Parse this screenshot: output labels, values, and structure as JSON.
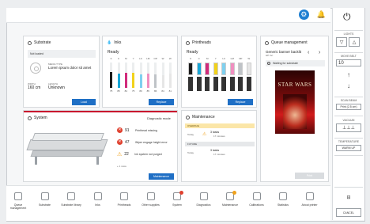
{
  "topbar": {
    "settings_icon": "gear-icon",
    "notifications_icon": "bell-icon"
  },
  "right_panel": {
    "power_icon": "power-icon",
    "lights_label": "LIGHTS",
    "movebelt_label": "MOVE BELT",
    "movebelt_value": "10",
    "scan_beam_label": "SCAN BEAM",
    "scan_beam_value": "Print (2.5 cm)",
    "vacuum_label": "VACUUM",
    "temperature_label": "TEMPERATURE",
    "temperature_value": "WARM UP",
    "cancel_label": "CANCEL"
  },
  "substrate": {
    "title": "Substrate",
    "status": "Not loaded",
    "media_type_label": "MEDIA TYPE",
    "media_type_value": "Lorem ipsum dolor sit amet",
    "width_label": "WIDTH",
    "width_value": "160 cm",
    "length_label": "LENGTH",
    "length_value": "Unknown",
    "load_button": "Load"
  },
  "inks": {
    "title": "Inks",
    "status": "Ready",
    "channel_labels": [
      "K",
      "C",
      "M",
      "Y",
      "LC",
      "LM",
      "OP",
      "W",
      "W"
    ],
    "levels": [
      0.62,
      0.55,
      0.58,
      0.6,
      0.52,
      0.57,
      0.54,
      0.5,
      0.56
    ],
    "level_labels": [
      "75",
      "85",
      "84",
      "75",
      "80",
      "85",
      "86",
      "84",
      "81"
    ],
    "colors": [
      "#1b1b1b",
      "#19a7d8",
      "#d12b7b",
      "#f2d21b",
      "#7fd0ef",
      "#f08fc0",
      "#bfc3c7",
      "#e6e6e6",
      "#e6e6e6"
    ],
    "replace_button": "Replace"
  },
  "printheads": {
    "title": "Printheads",
    "status": "Ready",
    "top_labels": [
      "K",
      "C",
      "M",
      "Y",
      "LC",
      "LM",
      "OP",
      "W"
    ],
    "replace_button": "Replace"
  },
  "queue": {
    "title": "Queue management",
    "job_name": "Generic banner backlit",
    "job_sub": "HP Inc.",
    "waiting_label": "Waiting for substrate",
    "poster_text": "STAR WARS",
    "print_button": "Print"
  },
  "system": {
    "title": "System",
    "mode": "Diagnostic mode",
    "alerts": [
      {
        "code": "91",
        "text": "Printhead missing",
        "severity": "error"
      },
      {
        "code": "47",
        "text": "Wiper engage height error",
        "severity": "error"
      },
      {
        "code": "22",
        "text": "Ink system not purged",
        "severity": "warning"
      }
    ],
    "more": "+ 1 more",
    "button": "Maintenance"
  },
  "maintenance": {
    "title": "Maintenance",
    "overdue_label": "OVERDUE",
    "overdue_row": {
      "when": "Today",
      "count": "3 tasks",
      "duration": "17 minutes"
    },
    "future_label": "FUTURE",
    "future_row": {
      "when": "Today",
      "count": "3 tasks",
      "duration": "17 minutes"
    }
  },
  "bottom_nav": [
    {
      "label": "Queue management",
      "icon": "queue-icon"
    },
    {
      "label": "Substrate",
      "icon": "substrate-icon"
    },
    {
      "label": "Substrate library",
      "icon": "library-icon"
    },
    {
      "label": "Inks",
      "icon": "ink-icon"
    },
    {
      "label": "Printheads",
      "icon": "printhead-icon"
    },
    {
      "label": "Other supplies",
      "icon": "supplies-icon"
    },
    {
      "label": "System",
      "icon": "system-icon"
    },
    {
      "label": "Diagnostics",
      "icon": "diagnostics-icon"
    },
    {
      "label": "Maintenance",
      "icon": "maintenance-icon"
    },
    {
      "label": "Calibrations",
      "icon": "calibrations-icon"
    },
    {
      "label": "Statistics",
      "icon": "statistics-icon"
    },
    {
      "label": "About printer",
      "icon": "about-icon"
    }
  ],
  "colors": {
    "accent": "#1f6fc5",
    "error": "#e0412f",
    "warning": "#f0a21c",
    "system_bar": "#c8102e"
  }
}
